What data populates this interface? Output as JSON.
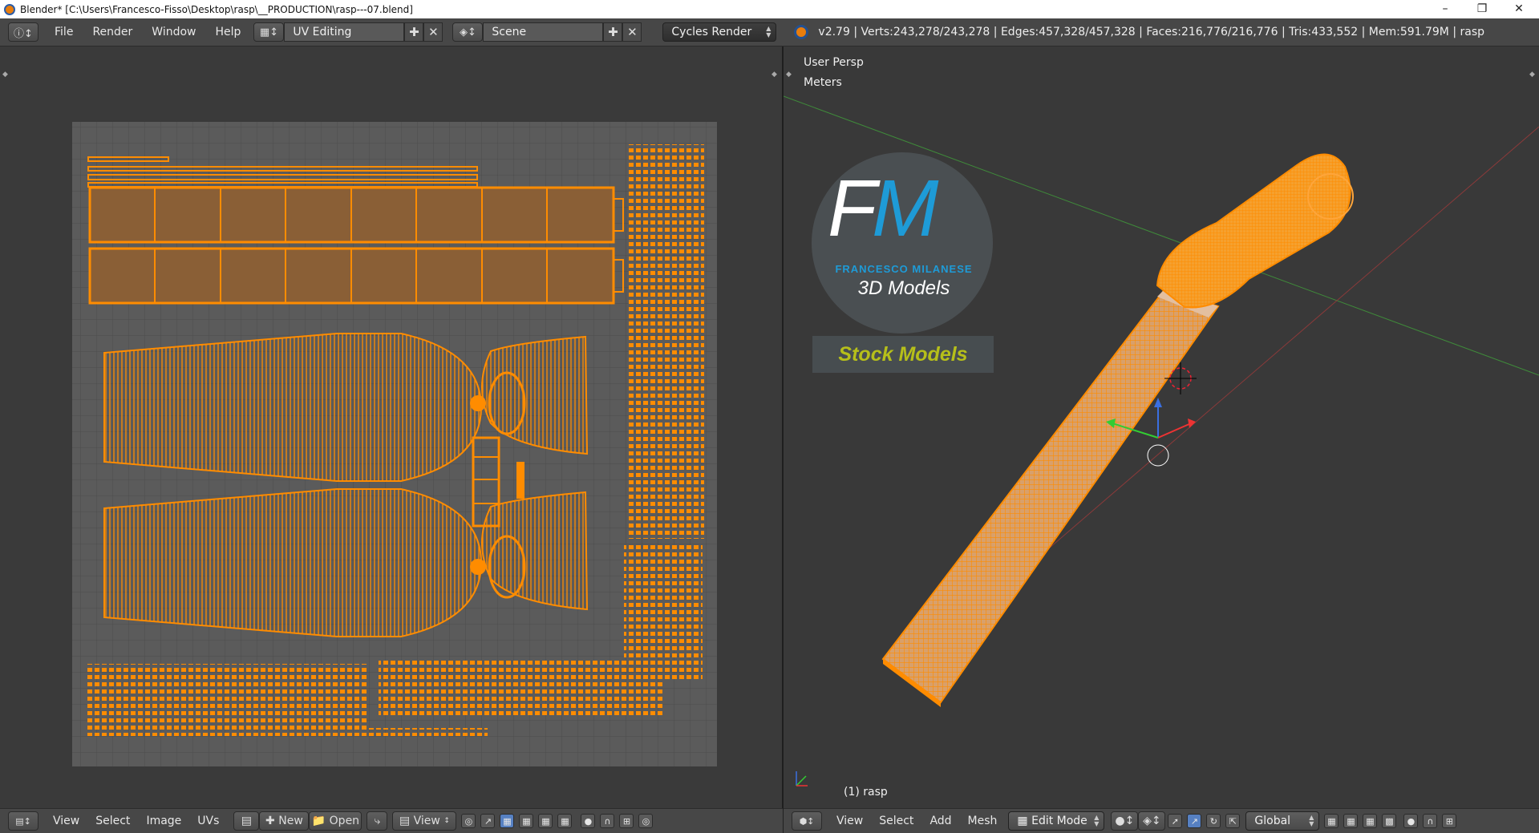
{
  "window": {
    "title": "Blender* [C:\\Users\\Francesco-Fisso\\Desktop\\rasp\\__PRODUCTION\\rasp---07.blend]",
    "controls": [
      "minimize",
      "maximize",
      "close"
    ]
  },
  "info_header": {
    "menus": [
      "File",
      "Render",
      "Window",
      "Help"
    ],
    "screen_layout": "UV Editing",
    "scene": "Scene",
    "render_engine": "Cycles Render",
    "stats": "v2.79 | Verts:243,278/243,278 | Edges:457,328/457,328 | Faces:216,776/216,776 | Tris:433,552 | Mem:591.79M | rasp"
  },
  "uv_editor": {
    "footer_menus": [
      "View",
      "Select",
      "Image",
      "UVs"
    ],
    "new_label": "New",
    "open_label": "Open",
    "view_label": "View"
  },
  "view3d": {
    "view_name": "User Persp",
    "units": "Meters",
    "object_label": "(1) rasp",
    "footer_menus": [
      "View",
      "Select",
      "Add",
      "Mesh"
    ],
    "mode": "Edit Mode",
    "orientation": "Global",
    "logo": {
      "initials": "FM",
      "author": "FRANCESCO MILANESE",
      "subtitle": "3D Models",
      "badge": "Stock Models"
    }
  },
  "colors": {
    "uv_orange": "#ff8c00",
    "stock_models_yellow": "#b6bf1a",
    "logo_blue": "#1e9bd7"
  }
}
